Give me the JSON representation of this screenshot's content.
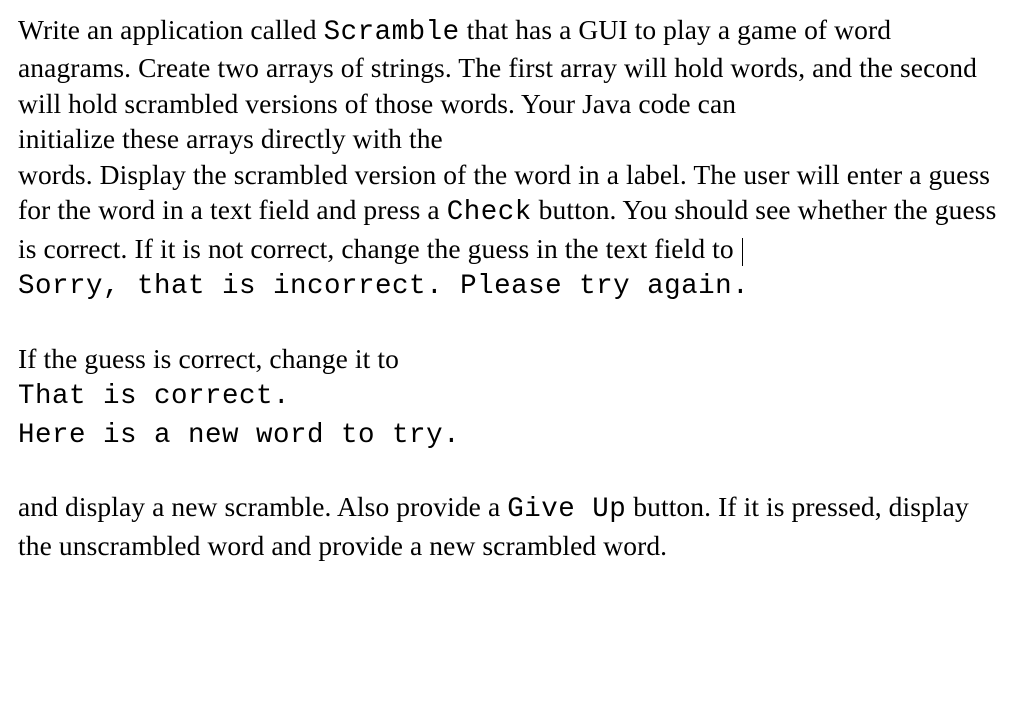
{
  "p1_a": "Write an application called ",
  "p1_code1": "Scramble",
  "p1_b": " that has a GUI to play a game of word anagrams. Create two arrays of strings. The first array will hold words, and the second will hold scrambled versions of those words. Your Java code can",
  "p1_c": "initialize these arrays directly with the",
  "p1_d": "words. Display the scrambled version of the word in a label. The user will enter a guess for the word in a text field and press a ",
  "p1_code2": "Check",
  "p1_e": " button. You should see whether the guess is correct. If it is not correct, change the guess in the text field to ",
  "p1_code3": "Sorry, that is incorrect. Please try again.",
  "p2_a": "If the guess is correct, change it to",
  "p2_code1": "That is correct.",
  "p2_code2": "Here is a new word to try.",
  "p3_a": "and display a new scramble. Also provide a ",
  "p3_code1": "Give Up",
  "p3_b": " button. If it is pressed, display the unscrambled word and provide a new scrambled word."
}
